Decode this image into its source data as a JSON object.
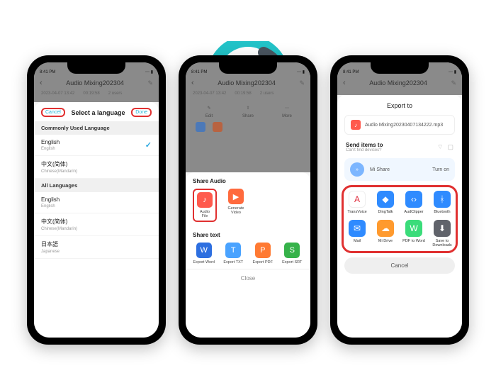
{
  "status": {
    "time": "8:41 PM",
    "icons": "⋯ ▮"
  },
  "header": {
    "title": "Audio Mixing202304",
    "meta": [
      "2023-04-07 13:42",
      "00:19:58",
      "2 users"
    ],
    "tools": [
      "Edit",
      "Share",
      "More"
    ]
  },
  "phone1": {
    "cancel": "Cancel",
    "title": "Select a language",
    "done": "Done",
    "section_common": "Commonly Used Language",
    "section_all": "All Languages",
    "languages": [
      {
        "name": "English",
        "sub": "English",
        "checked": true
      },
      {
        "name": "中文(简体)",
        "sub": "Chinese(Mandarin)",
        "checked": false
      },
      {
        "name": "English",
        "sub": "English",
        "checked": false
      },
      {
        "name": "中文(简体)",
        "sub": "Chinese(Mandarin)",
        "checked": false
      },
      {
        "name": "日本語",
        "sub": "Japanese",
        "checked": false
      }
    ]
  },
  "phone2": {
    "share_audio_title": "Share Audio",
    "audio_items": [
      {
        "label": "Audio File",
        "color": "#ff5a4d",
        "glyph": "♪"
      },
      {
        "label": "Generate Video",
        "color": "#ff6a3d",
        "glyph": "▶"
      }
    ],
    "share_text_title": "Share text",
    "text_items": [
      {
        "label": "Export Word",
        "color": "#2d6fe0",
        "glyph": "W"
      },
      {
        "label": "Export TXT",
        "color": "#4aa3ff",
        "glyph": "T"
      },
      {
        "label": "Export PDF",
        "color": "#ff7a33",
        "glyph": "P"
      },
      {
        "label": "Export SRT",
        "color": "#36b24a",
        "glyph": "S"
      }
    ],
    "close": "Close"
  },
  "phone3": {
    "export_title": "Export to",
    "file": "Audio Mixing20230407134222.mp3",
    "send_title": "Send items to",
    "send_sub": "Can't find devices?",
    "mishare_label": "Mi Share",
    "mishare_action": "Turn on",
    "apps": [
      {
        "label": "TransVoice",
        "color": "#ffffff",
        "fg": "#e24",
        "glyph": "⬚"
      },
      {
        "label": "DingTalk",
        "color": "#2f8bff",
        "glyph": "◆"
      },
      {
        "label": "AudClipper",
        "color": "#2f8bff",
        "glyph": "‹›"
      },
      {
        "label": "Bluetooth",
        "color": "#2f8bff",
        "glyph": "✱"
      },
      {
        "label": "Mail",
        "color": "#2f8bff",
        "glyph": "✉"
      },
      {
        "label": "Mi Drive",
        "color": "#ff9a2e",
        "glyph": "☁"
      },
      {
        "label": "PDF to Word",
        "color": "#3adc7a",
        "glyph": "W"
      },
      {
        "label": "Save to Downloads",
        "color": "#60636b",
        "glyph": "⬇"
      }
    ],
    "cancel": "Cancel"
  }
}
